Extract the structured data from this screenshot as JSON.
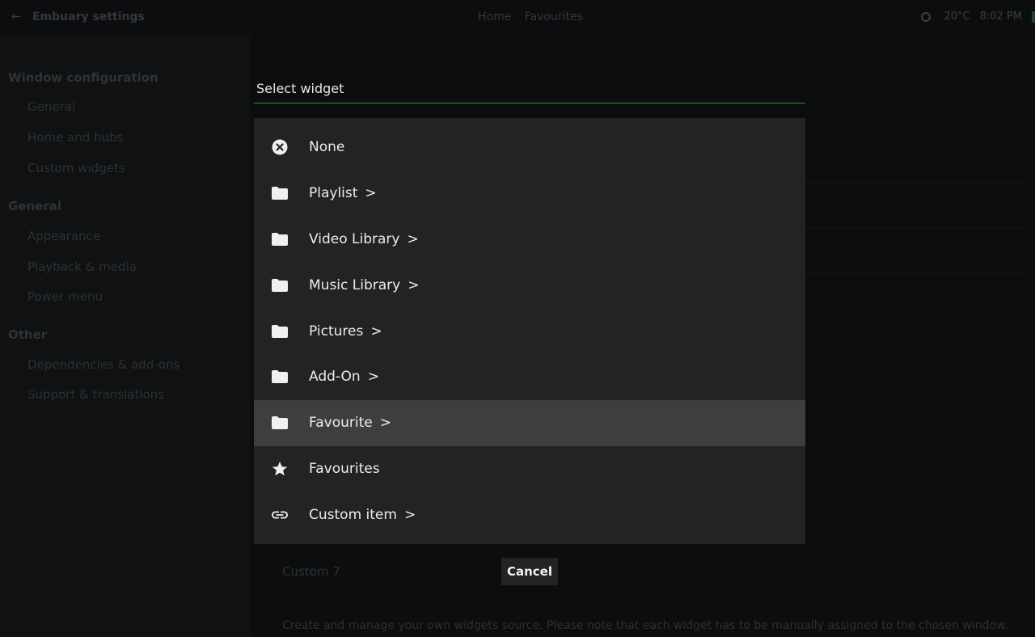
{
  "background": {
    "header": {
      "back_glyph": "←",
      "title": "Embuary settings",
      "breadcrumbs": [
        "Home",
        "Favourites"
      ],
      "temperature": "20°C",
      "time": "8:02 PM"
    },
    "sidebar": {
      "groups": [
        {
          "label": "Window configuration",
          "items": [
            "General",
            "Home and hubs",
            "Custom widgets"
          ]
        },
        {
          "label": "General",
          "items": [
            "Appearance",
            "Playback & media",
            "Power menu"
          ]
        },
        {
          "label": "Other",
          "items": [
            "Dependencies & add-ons",
            "Support & translations"
          ]
        }
      ]
    },
    "main": {
      "custom_item_label": "Custom 7",
      "footnote": "Create and manage your own widgets source. Please note that each widget has to be manually assigned to the chosen window."
    }
  },
  "dialog": {
    "title": "Select widget",
    "accent_color": "#3c8a3c",
    "items": [
      {
        "label": "None",
        "icon": "close-circle-icon",
        "arrow": ""
      },
      {
        "label": "Playlist",
        "icon": "folder-icon",
        "arrow": ">"
      },
      {
        "label": "Video Library",
        "icon": "folder-icon",
        "arrow": ">"
      },
      {
        "label": "Music Library",
        "icon": "folder-icon",
        "arrow": ">"
      },
      {
        "label": "Pictures",
        "icon": "folder-icon",
        "arrow": ">"
      },
      {
        "label": "Add-On",
        "icon": "folder-icon",
        "arrow": ">"
      },
      {
        "label": "Favourite",
        "icon": "folder-icon",
        "arrow": ">"
      },
      {
        "label": "Favourites",
        "icon": "star-icon",
        "arrow": ""
      },
      {
        "label": "Custom item",
        "icon": "link-icon",
        "arrow": ">"
      }
    ],
    "focused_item": "Favourite",
    "cancel_label": "Cancel"
  }
}
